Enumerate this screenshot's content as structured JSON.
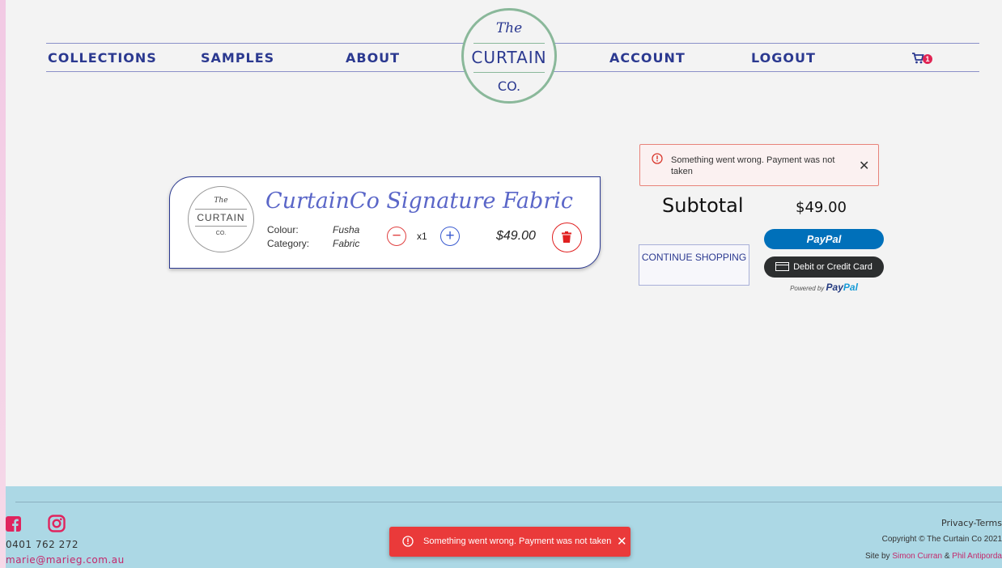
{
  "nav": {
    "collections": "COLLECTIONS",
    "samples": "SAMPLES",
    "about": "ABOUT",
    "account": "ACCOUNT",
    "logout": "LOGOUT",
    "cart_count": "1"
  },
  "logo": {
    "the": "The",
    "curtain": "CURTAIN",
    "co": "CO."
  },
  "cart_item": {
    "logo_the": "The",
    "logo_curtain": "CURTAIN",
    "logo_co": "CO.",
    "title": "CurtainCo Signature Fabric",
    "colour_label": "Colour:",
    "colour_value": "Fusha",
    "category_label": "Category:",
    "category_value": "Fabric",
    "quantity": "x1",
    "price": "$49.00"
  },
  "alert": {
    "message": "Something went wrong. Payment was not taken",
    "close": "✕"
  },
  "summary": {
    "subtotal_label": "Subtotal",
    "subtotal_value": "$49.00",
    "continue_label": "CONTINUE SHOPPING",
    "paypal_label": "PayPal",
    "card_label": "Debit or Credit Card",
    "powered_by": "Powered by",
    "powered_pay": "Pay",
    "powered_pal": "Pal"
  },
  "footer": {
    "phone": "0401 762 272",
    "email": "marie@marieg.com.au",
    "privacy_terms": "Privacy-Terms",
    "copyright": "Copyright © The Curtain Co 2021",
    "site_by": "Site by",
    "author1": "Simon Curran",
    "amp": "&",
    "author2": "Phil Antiporda"
  },
  "toast": {
    "message": "Something went wrong. Payment was not taken",
    "close": "✕"
  },
  "colors": {
    "brand_blue": "#2b3990",
    "accent_pink": "#e0245e",
    "logo_green": "#8ab89a",
    "footer_bg": "#acd8e5",
    "error_red": "#ea3a3a",
    "paypal_blue": "#0070ba"
  }
}
